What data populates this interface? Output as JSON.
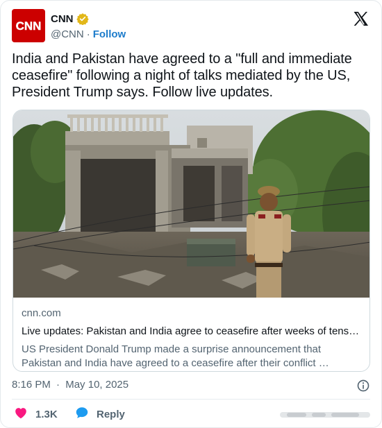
{
  "account": {
    "avatar_text": "CNN",
    "name": "CNN",
    "handle": "@CNN",
    "separator": "·",
    "follow_label": "Follow",
    "verified_color": "#e2b719",
    "brand_color": "#cc0000"
  },
  "tweet": {
    "text": "India and Pakistan have agreed to a \"full and immediate ceasefire\" following a night of talks mediated by the US, President Trump says. Follow live updates."
  },
  "link_card": {
    "domain": "cnn.com",
    "title": "Live updates: Pakistan and India agree to ceasefire after weeks of tensi…",
    "description": "US President Donald Trump made a surprise announcement that Pakistan and India have agreed to a ceasefire after their conflict …"
  },
  "meta": {
    "time": "8:16 PM",
    "separator": "·",
    "date": "May 10, 2025"
  },
  "actions": {
    "like_count": "1.3K",
    "reply_label": "Reply",
    "like_color": "#f91880",
    "reply_color": "#1d9bf0"
  },
  "icons": [
    "verified-icon",
    "x-logo-icon",
    "info-icon",
    "heart-icon",
    "reply-bubble-icon"
  ]
}
